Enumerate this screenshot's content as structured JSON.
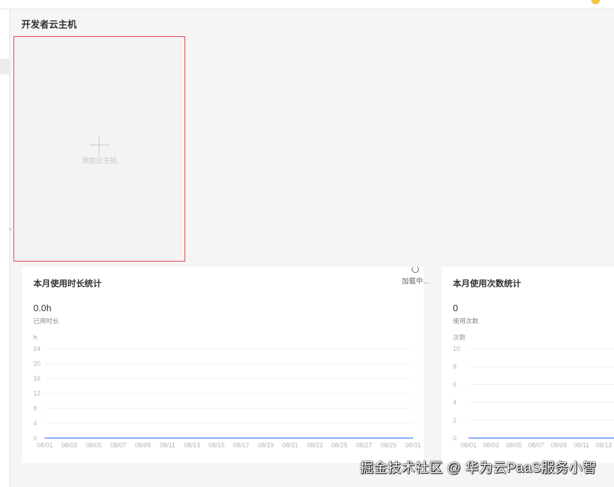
{
  "section": {
    "title": "开发者云主机"
  },
  "add_card": {
    "label": "添加云主机",
    "icon": "plus-icon"
  },
  "left_panel": {
    "title": "本月使用时长统计",
    "loading_text": "加载中...",
    "stat_value": "0.0h",
    "stat_label": "已用时长"
  },
  "right_panel": {
    "title": "本月使用次数统计",
    "stat_value": "0",
    "stat_label": "使用次数"
  },
  "watermark": "掘金技术社区 @ 华为云PaaS服务小智",
  "colors": {
    "accent_line": "#5b8ff9",
    "card_border": "#e0454b",
    "grid": "#f0f0f0"
  },
  "chart_data": [
    {
      "type": "line",
      "ylabel": "h",
      "ylim": [
        0,
        24
      ],
      "y_ticks": [
        0,
        4,
        8,
        12,
        16,
        20,
        24
      ],
      "categories": [
        "08/01",
        "08/03",
        "08/05",
        "08/07",
        "08/09",
        "08/11",
        "08/13",
        "08/15",
        "08/17",
        "08/19",
        "08/21",
        "08/23",
        "08/25",
        "08/27",
        "08/29",
        "08/31"
      ],
      "series": [
        {
          "values": [
            0,
            0,
            0,
            0,
            0,
            0,
            0,
            0,
            0,
            0,
            0,
            0,
            0,
            0,
            0,
            0
          ]
        }
      ]
    },
    {
      "type": "line",
      "ylabel": "次数",
      "ylim": [
        0,
        10
      ],
      "y_ticks": [
        0,
        2,
        4,
        6,
        8,
        10
      ],
      "categories": [
        "08/01",
        "08/03",
        "08/05",
        "08/07",
        "08/09",
        "08/11",
        "08/13"
      ],
      "series": [
        {
          "values": [
            0,
            0,
            0,
            0,
            0,
            0,
            0
          ]
        }
      ]
    }
  ]
}
